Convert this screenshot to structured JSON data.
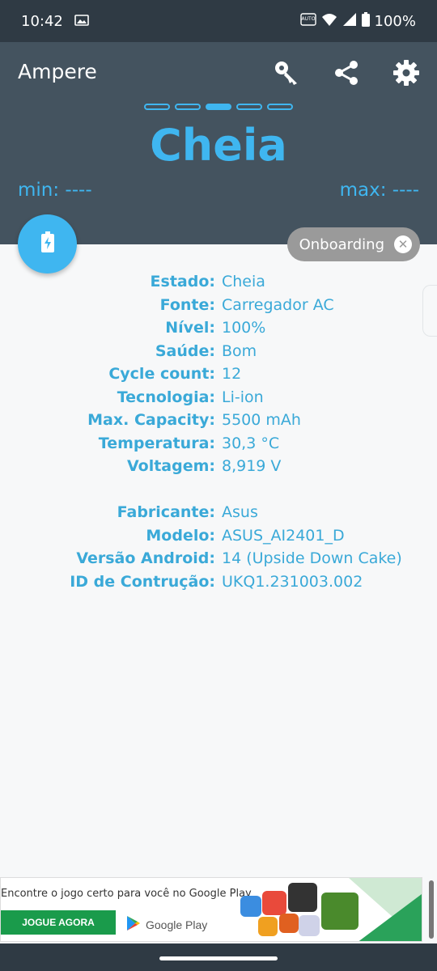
{
  "status_bar": {
    "time": "10:42",
    "battery_percent": "100%",
    "icons": [
      "image-icon",
      "auto-hd-icon",
      "wifi-icon",
      "signal-icon",
      "battery-icon"
    ]
  },
  "header": {
    "title": "Ampere",
    "icons": [
      "key-icon",
      "share-icon",
      "gear-icon"
    ],
    "state": "Cheia",
    "min_label": "min: ----",
    "max_label": "max: ----",
    "page_indicator": {
      "count": 5,
      "active_index": 2
    }
  },
  "fab": {
    "icon": "battery-charging-icon"
  },
  "chip": {
    "label": "Onboarding",
    "close_icon": "close-icon"
  },
  "info": {
    "battery": [
      {
        "key": "Estado:",
        "value": "Cheia"
      },
      {
        "key": "Fonte:",
        "value": "Carregador AC"
      },
      {
        "key": "Nível:",
        "value": "100%"
      },
      {
        "key": "Saúde:",
        "value": "Bom"
      },
      {
        "key": "Cycle count:",
        "value": "12"
      },
      {
        "key": "Tecnologia:",
        "value": "Li-ion"
      },
      {
        "key": "Max. Capacity:",
        "value": "5500 mAh"
      },
      {
        "key": "Temperatura:",
        "value": "30,3 °C"
      },
      {
        "key": "Voltagem:",
        "value": "8,919 V"
      }
    ],
    "device": [
      {
        "key": "Fabricante:",
        "value": "Asus"
      },
      {
        "key": "Modelo:",
        "value": "ASUS_AI2401_D"
      },
      {
        "key": "Versão Android:",
        "value": "14 (Upside Down Cake)"
      },
      {
        "key": "ID de Contrução:",
        "value": "UKQ1.231003.002"
      }
    ]
  },
  "ad": {
    "headline": "Encontre o jogo certo para você no Google Play",
    "button": "JOGUE AGORA",
    "store": "Google Play"
  },
  "colors": {
    "accent": "#3fb6f0",
    "header_bg": "#44535f",
    "status_bg": "#2f3a44",
    "chip_bg": "#9a9a9a",
    "ad_button": "#1a9b4b"
  }
}
